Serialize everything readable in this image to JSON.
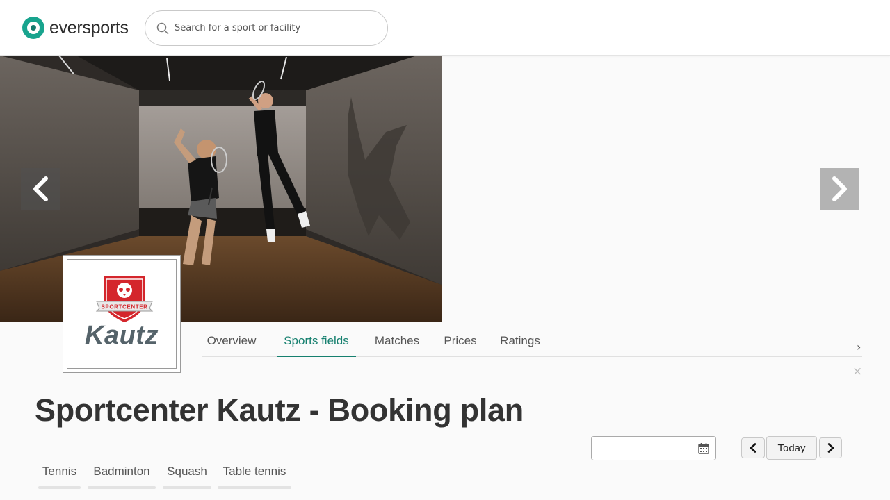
{
  "header": {
    "brand": "eversports",
    "search_placeholder": "Search for a sport or facility"
  },
  "facility_logo": {
    "crest_text": "SPORTCENTER",
    "wordmark": "Kautz"
  },
  "tabs": [
    {
      "label": "Overview",
      "active": false
    },
    {
      "label": "Sports fields",
      "active": true
    },
    {
      "label": "Matches",
      "active": false
    },
    {
      "label": "Prices",
      "active": false
    },
    {
      "label": "Ratings",
      "active": false
    }
  ],
  "tabs_more_glyph": "›",
  "close_glyph": "×",
  "page_title": "Sportcenter Kautz - Booking plan",
  "date_controls": {
    "date_value": "",
    "today_label": "Today"
  },
  "sport_filters": [
    {
      "label": "Tennis"
    },
    {
      "label": "Badminton"
    },
    {
      "label": "Squash"
    },
    {
      "label": "Table tennis"
    }
  ],
  "icons": {
    "search": "search-icon",
    "prev_slide": "chevron-left-icon",
    "next_slide": "chevron-right-icon",
    "calendar": "calendar-icon",
    "prev_day": "chevron-left-icon",
    "next_day": "chevron-right-icon"
  },
  "colors": {
    "brand": "#18a48e",
    "active_tab": "#16806f",
    "crest_red": "#d4262c",
    "wordmark": "#55636a"
  }
}
